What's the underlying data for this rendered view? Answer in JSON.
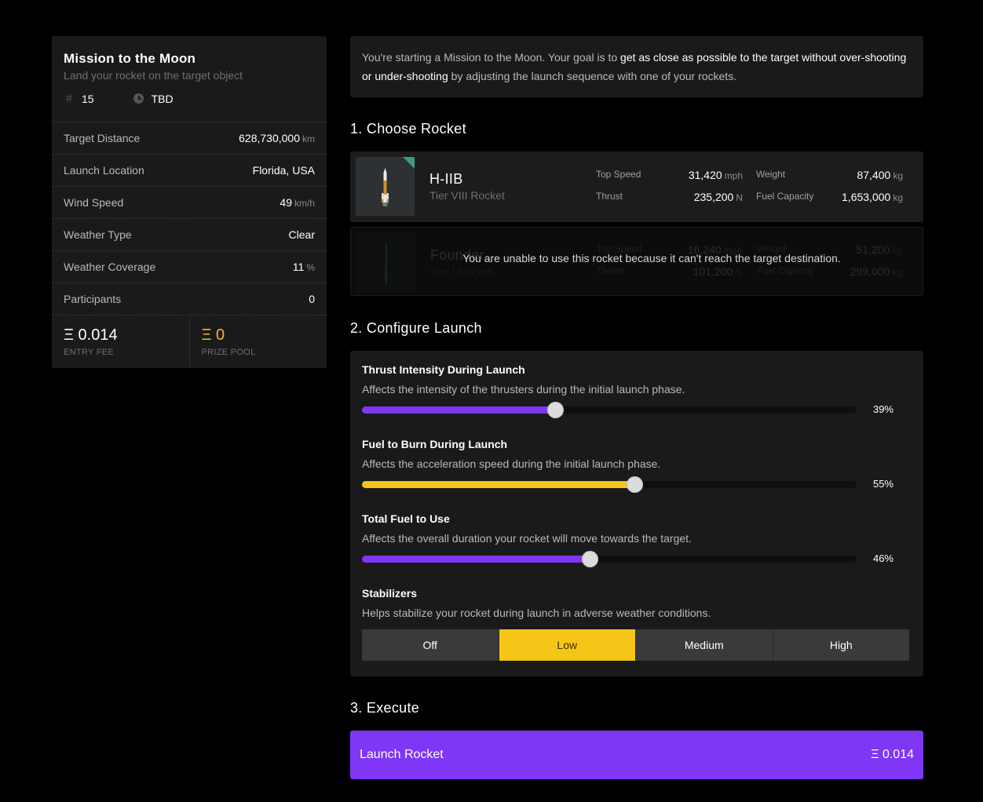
{
  "mission": {
    "title": "Mission to the Moon",
    "subtitle": "Land your rocket on the target object",
    "id_icon": "hash-icon",
    "number": "15",
    "time_icon": "clock-icon",
    "time": "TBD"
  },
  "stats": [
    {
      "label": "Target Distance",
      "value": "628,730,000",
      "unit": "km"
    },
    {
      "label": "Launch Location",
      "value": "Florida, USA",
      "unit": ""
    },
    {
      "label": "Wind Speed",
      "value": "49",
      "unit": "km/h"
    },
    {
      "label": "Weather Type",
      "value": "Clear",
      "unit": ""
    },
    {
      "label": "Weather Coverage",
      "value": "11",
      "unit": "%"
    },
    {
      "label": "Participants",
      "value": "0",
      "unit": ""
    }
  ],
  "fees": {
    "entry_value": "Ξ 0.014",
    "entry_label": "ENTRY FEE",
    "prize_value": "Ξ 0",
    "prize_label": "PRIZE POOL"
  },
  "intro": {
    "part1": "You're starting a Mission to the Moon. Your goal is to ",
    "emphasis": "get as close as possible to the target without over-shooting or under-shooting",
    "part2": " by adjusting the launch sequence with one of your rockets."
  },
  "sections": {
    "choose": "1. Choose Rocket",
    "configure": "2. Configure Launch",
    "execute": "3. Execute"
  },
  "rockets": [
    {
      "name": "H-IIB",
      "tier": "Tier VIII Rocket",
      "top_speed_label": "Top Speed",
      "top_speed": "31,420",
      "top_speed_unit": "mph",
      "thrust_label": "Thrust",
      "thrust": "235,200",
      "thrust_unit": "N",
      "weight_label": "Weight",
      "weight": "87,400",
      "weight_unit": "kg",
      "fuel_label": "Fuel Capacity",
      "fuel": "1,653,000",
      "fuel_unit": "kg"
    },
    {
      "name": "Founder",
      "tier": "Tier I Rocket",
      "top_speed_label": "Top Speed",
      "top_speed": "16,240",
      "top_speed_unit": "mph",
      "thrust_label": "Thrust",
      "thrust": "101,200",
      "thrust_unit": "N",
      "weight_label": "Weight",
      "weight": "51,200",
      "weight_unit": "kg",
      "fuel_label": "Fuel Capacity",
      "fuel": "299,000",
      "fuel_unit": "kg",
      "disabled_message": "You are unable to use this rocket because it can't reach the target destination."
    }
  ],
  "config": {
    "thrust": {
      "title": "Thrust Intensity During Launch",
      "desc": "Affects the intensity of the thrusters during the initial launch phase.",
      "percent": 39,
      "label": "39%",
      "color": "#7f36f5"
    },
    "burn": {
      "title": "Fuel to Burn During Launch",
      "desc": "Affects the acceleration speed during the initial launch phase.",
      "percent": 55,
      "label": "55%",
      "color": "#f5c518"
    },
    "total": {
      "title": "Total Fuel to Use",
      "desc": "Affects the overall duration your rocket will move towards the target.",
      "percent": 46,
      "label": "46%",
      "color": "#7f36f5"
    },
    "stabilizers": {
      "title": "Stabilizers",
      "desc": "Helps stabilize your rocket during launch in adverse weather conditions.",
      "options": [
        "Off",
        "Low",
        "Medium",
        "High"
      ],
      "selected": "Low"
    }
  },
  "launch": {
    "label": "Launch Rocket",
    "price": "Ξ 0.014"
  },
  "colors": {
    "accent_purple": "#7f36f5",
    "accent_gold": "#f5c518",
    "panel": "#1a1a1a"
  }
}
